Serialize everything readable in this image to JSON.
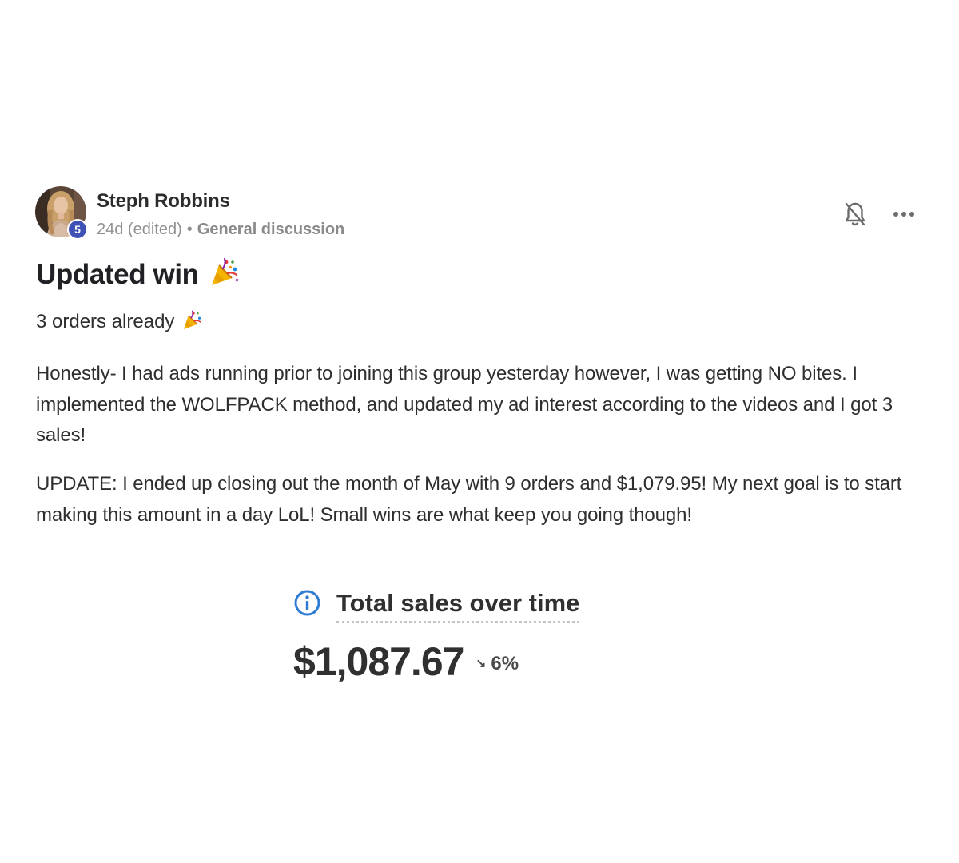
{
  "post": {
    "author": {
      "name": "Steph Robbins",
      "level": "5"
    },
    "meta": {
      "age": "24d (edited)",
      "separator": "•",
      "category": "General discussion"
    },
    "title": "Updated win",
    "first_line": "3 orders already",
    "paragraphs": [
      "Honestly- I had ads running prior to joining this group yesterday however, I was getting NO bites. I implemented the WOLFPACK method, and updated my ad interest according to the videos and I got 3 sales!",
      "UPDATE: I ended up closing out the month of May with 9 orders and $1,079.95! My next goal is to start making this amount in a day LoL! Small wins are what keep you going though!"
    ],
    "emoji": "party-popper-emoji"
  },
  "actions": {
    "bell_icon": "bell-off-icon",
    "more_icon": "more-horizontal-icon"
  },
  "sales_widget": {
    "title": "Total sales over time",
    "amount": "$1,087.67",
    "trend_arrow": "↘",
    "change": "6%",
    "info_icon": "info-icon",
    "accent_color": "#2f7dd3"
  },
  "colors": {
    "level_badge": "#3f51b5",
    "text": "#202124",
    "muted": "#909090"
  }
}
